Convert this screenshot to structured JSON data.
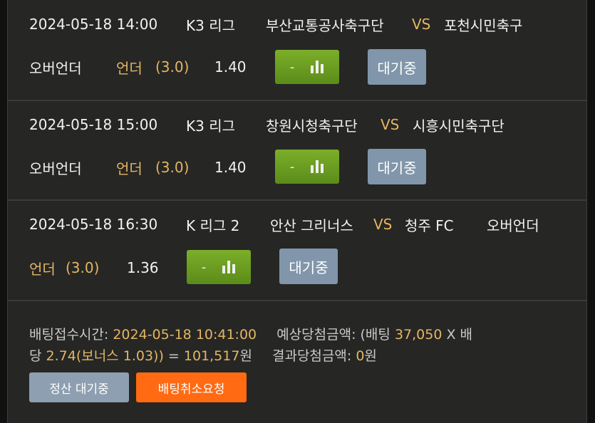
{
  "bets": [
    {
      "datetime": "2024-05-18 14:00",
      "league": "K3 리그",
      "home": "부산교통공사축구단",
      "vs": "VS",
      "away": "포천시민축구",
      "market": "오버언더",
      "pick": "언더",
      "line": "(3.0)",
      "odds": "1.40",
      "dash": "-",
      "status": "대기중"
    },
    {
      "datetime": "2024-05-18 15:00",
      "league": "K3 리그",
      "home": "창원시청축구단",
      "vs": "VS",
      "away": "시흥시민축구단",
      "market": "오버언더",
      "pick": "언더",
      "line": "(3.0)",
      "odds": "1.40",
      "dash": "-",
      "status": "대기중"
    },
    {
      "datetime": "2024-05-18 16:30",
      "league": "K 리그 2",
      "home": "안산 그리너스",
      "vs": "VS",
      "away": "청주 FC",
      "market": "오버언더",
      "pick": "언더",
      "line": "(3.0)",
      "odds": "1.36",
      "dash": "-",
      "status": "대기중"
    }
  ],
  "summary": {
    "receipt_label": "배팅접수시간:",
    "receipt_time": "2024-05-18  10:41:00",
    "expected_label": "예상당첨금액: (배팅",
    "stake": "37,050",
    "x_label": "X 배",
    "dang": "당",
    "odds_total": "2.74(보너스  1.03))",
    "eq": "=",
    "payout": "101,517",
    "won": "원",
    "result_label": "결과당첨금액:",
    "result_value": "0",
    "result_won": "원"
  },
  "buttons": {
    "settle": "정산  대기중",
    "cancel": "배팅취소요청"
  },
  "colors": {
    "accent_gold": "#e3b662",
    "chart_green": "#6a9d21",
    "wait_blue": "#8196aa",
    "cancel_orange": "#ff6a13"
  },
  "icons": {
    "stats": "bar-chart-icon"
  }
}
